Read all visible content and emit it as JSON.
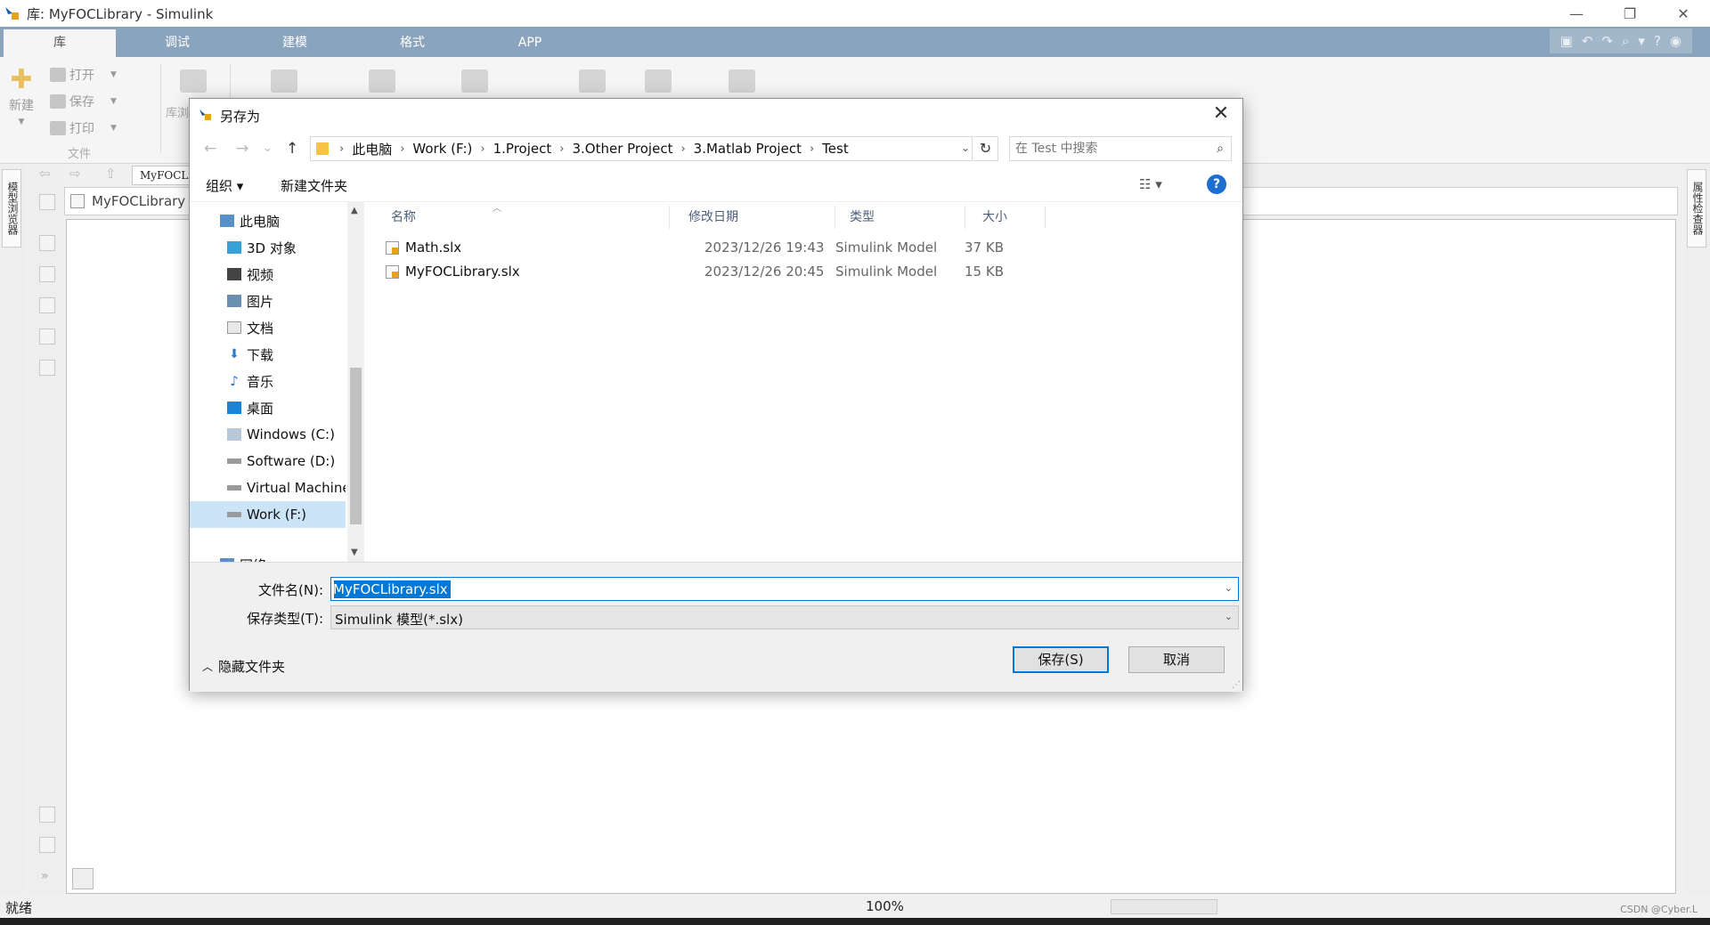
{
  "window": {
    "title": "库: MyFOCLibrary - Simulink",
    "controls": {
      "minimize": "—",
      "restore": "❐",
      "close": "✕"
    }
  },
  "ribbon": {
    "tabs": [
      {
        "label": "库",
        "active": true
      },
      {
        "label": "调试",
        "active": false
      },
      {
        "label": "建模",
        "active": false
      },
      {
        "label": "格式",
        "active": false
      },
      {
        "label": "APP",
        "active": false
      }
    ],
    "new_label": "新建",
    "open_label": "打开",
    "save_label": "保存",
    "print_label": "打印",
    "file_group_label": "文件",
    "lib_label": "库浏"
  },
  "editor": {
    "left_vtab": "模型浏览器",
    "right_vtab": "属性检查器",
    "breadcrumb_chip": "MyFOCLi",
    "library_name": "MyFOCLibrary"
  },
  "dialog": {
    "title": "另存为",
    "close_icon": "✕",
    "nav": {
      "back": "←",
      "forward": "→",
      "recent": "⌄",
      "up": "↑",
      "refresh": "↻"
    },
    "breadcrumb": [
      "此电脑",
      "Work (F:)",
      "1.Project",
      "3.Other Project",
      "3.Matlab Project",
      "Test"
    ],
    "search_placeholder": "在 Test 中搜索",
    "toolbar": {
      "organize": "组织 ▾",
      "new_folder": "新建文件夹",
      "view": "☷ ▾",
      "help": "?"
    },
    "tree": [
      {
        "label": "此电脑",
        "icon": "pc-icon",
        "indent": 0
      },
      {
        "label": "3D 对象",
        "icon": "3d-objects-icon",
        "indent": 1
      },
      {
        "label": "视频",
        "icon": "video-icon",
        "indent": 1
      },
      {
        "label": "图片",
        "icon": "pictures-icon",
        "indent": 1
      },
      {
        "label": "文档",
        "icon": "documents-icon",
        "indent": 1
      },
      {
        "label": "下载",
        "icon": "downloads-icon",
        "indent": 1
      },
      {
        "label": "音乐",
        "icon": "music-icon",
        "indent": 1
      },
      {
        "label": "桌面",
        "icon": "desktop-icon",
        "indent": 1
      },
      {
        "label": "Windows (C:)",
        "icon": "drive-windows-icon",
        "indent": 1
      },
      {
        "label": "Software (D:)",
        "icon": "drive-icon",
        "indent": 1
      },
      {
        "label": "Virtual Machine",
        "icon": "drive-icon",
        "indent": 1
      },
      {
        "label": "Work (F:)",
        "icon": "drive-icon",
        "indent": 1,
        "selected": true
      },
      {
        "label": "网络",
        "icon": "network-icon",
        "indent": 0
      }
    ],
    "columns": {
      "name": "名称",
      "date": "修改日期",
      "type": "类型",
      "size": "大小"
    },
    "files": [
      {
        "name": "Math.slx",
        "date": "2023/12/26 19:43",
        "type": "Simulink Model",
        "size": "37 KB"
      },
      {
        "name": "MyFOCLibrary.slx",
        "date": "2023/12/26 20:45",
        "type": "Simulink Model",
        "size": "15 KB"
      }
    ],
    "filename_label": "文件名(N):",
    "filename_value": "MyFOCLibrary.slx",
    "filetype_label": "保存类型(T):",
    "filetype_value": "Simulink 模型(*.slx)",
    "hide_folders": "隐藏文件夹",
    "save_button": "保存(S)",
    "cancel_button": "取消"
  },
  "status": {
    "left": "就绪",
    "zoom": "100%",
    "watermark": "CSDN @Cyber.L"
  },
  "colors": {
    "ribbon_tabs_bg": "#8aa4bd",
    "selection": "#0078d7",
    "tree_selected": "#cce4f7"
  }
}
